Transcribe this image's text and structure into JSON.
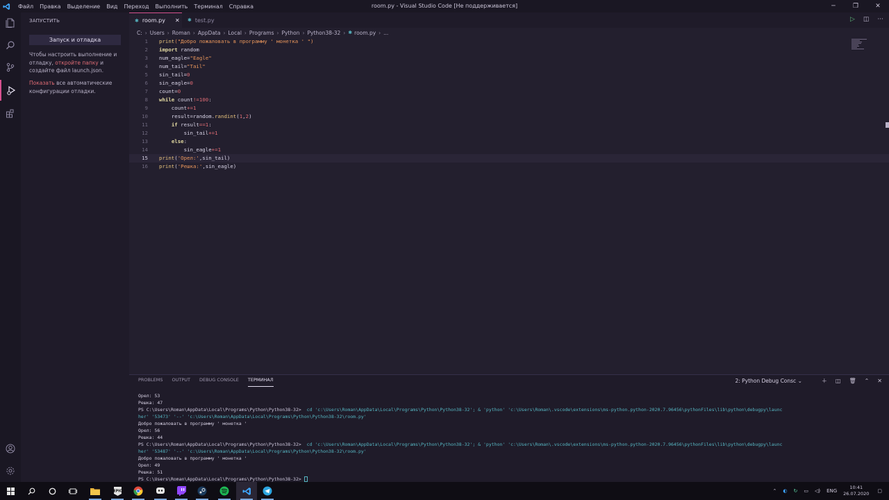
{
  "window": {
    "title": "room.py - Visual Studio Code [Не поддерживается]",
    "menu": [
      "Файл",
      "Правка",
      "Выделение",
      "Вид",
      "Переход",
      "Выполнить",
      "Терминал",
      "Справка"
    ]
  },
  "sidebar": {
    "header": "ЗАПУСТИТЬ",
    "run_button": "Запуск и отладка",
    "para1_a": "Чтобы настроить выполнение и отладку,",
    "para1_link": "откройте папку",
    "para1_b": "и создайте файл launch.json.",
    "para2_link": "Показать",
    "para2_b": "все автоматические конфигурации отладки."
  },
  "tabs": [
    {
      "label": "room.py",
      "close": "✕"
    },
    {
      "label": "test.py"
    }
  ],
  "breadcrumb": [
    "C:",
    "Users",
    "Roman",
    "AppData",
    "Local",
    "Programs",
    "Python",
    "Python38-32",
    "room.py",
    "..."
  ],
  "code": {
    "line_numbers": [
      "1",
      "2",
      "3",
      "4",
      "5",
      "6",
      "7",
      "8",
      "9",
      "10",
      "11",
      "12",
      "13",
      "14",
      "15",
      "16"
    ],
    "l1": [
      "print",
      "(\"Добро пожаловать в программу ' монетка ' \")"
    ],
    "l2": [
      "import",
      " random"
    ],
    "l3": [
      "num_eagle=",
      "\"Eagle\""
    ],
    "l4": [
      "num_tail=",
      "\"Tail\""
    ],
    "l5": [
      "sin_tail=",
      "0"
    ],
    "l6": [
      "sin_eagle=",
      "0"
    ],
    "l7": [
      "count=",
      "0"
    ],
    "l8": [
      "while",
      " count",
      "!=",
      "100",
      ":"
    ],
    "l9": [
      "    count",
      "+=",
      "1"
    ],
    "l10": [
      "    result=random.",
      "randint",
      "(",
      "1",
      ",",
      "2",
      ")"
    ],
    "l11": [
      "    ",
      "if",
      " result",
      "==",
      "1",
      ":"
    ],
    "l12": [
      "        sin_tail",
      "+=",
      "1"
    ],
    "l13": [
      "    ",
      "else",
      ":"
    ],
    "l14": [
      "        sin_eagle",
      "+=",
      "1"
    ],
    "l15": [
      "print",
      "(",
      "'Орел:'",
      ",sin_tail)"
    ],
    "l16": [
      "print",
      "(",
      "'Решка:'",
      ",sin_eagle)"
    ]
  },
  "panel": {
    "tabs": [
      "PROBLEMS",
      "OUTPUT",
      "DEBUG CONSOLE",
      "ТЕРМИНАЛ"
    ],
    "terminal_select": "2: Python Debug Consc",
    "terminal": {
      "t1": "Орел: 53",
      "t2": "Решка: 47",
      "t3_prompt": "PS C:\\Users\\Roman\\AppData\\Local\\Programs\\Python\\Python38-32> ",
      "t3_cmd": " cd 'c:\\Users\\Roman\\AppData\\Local\\Programs\\Python\\Python38-32'; & 'python' 'c:\\Users\\Roman\\.vscode\\extensions\\ms-python.python-2020.7.96456\\pythonFiles\\lib\\python\\debugpy\\launc",
      "t4": "her' '53473' '--' 'c:\\Users\\Roman\\AppData\\Local\\Programs\\Python\\Python38-32\\room.py'",
      "t5": "Добро пожаловать в программу ' монетка '",
      "t6": "Орел: 56",
      "t7": "Решка: 44",
      "t8_prompt": "PS C:\\Users\\Roman\\AppData\\Local\\Programs\\Python\\Python38-32> ",
      "t8_cmd": " cd 'c:\\Users\\Roman\\AppData\\Local\\Programs\\Python\\Python38-32'; & 'python' 'c:\\Users\\Roman\\.vscode\\extensions\\ms-python.python-2020.7.96456\\pythonFiles\\lib\\python\\debugpy\\launc",
      "t9": "her' '53487' '--' 'c:\\Users\\Roman\\AppData\\Local\\Programs\\Python\\Python38-32\\room.py'",
      "t10": "Добро пожаловать в программу ' монетка '",
      "t11": "Орел: 49",
      "t12": "Решка: 51",
      "t13_prompt": "PS C:\\Users\\Roman\\AppData\\Local\\Programs\\Python\\Python38-32> "
    }
  },
  "taskbar": {
    "lang": "ENG",
    "time": "10:41",
    "date": "26.07.2020"
  },
  "colors": {
    "accent": "#d6518f",
    "editor_bg": "#231f2e",
    "sidebar_bg": "#1f1b29"
  }
}
